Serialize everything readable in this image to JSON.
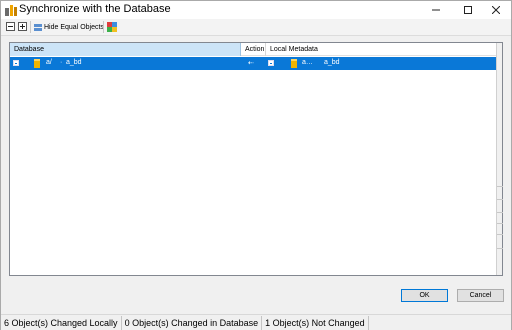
{
  "window": {
    "title": "Synchronize with the Database"
  },
  "toolbar": {
    "hide_equal_label": "Hide Equal Objects"
  },
  "grid": {
    "columns": {
      "database": "Database",
      "action": "Action",
      "local": "Local Metadata"
    },
    "rows": [
      {
        "db_name": "a_bd",
        "db_prefix": "a/",
        "db_mark": "·",
        "local_name": "a_bd",
        "local_prefix": "a…",
        "action": "⇠"
      }
    ]
  },
  "buttons": {
    "ok": "OK",
    "cancel": "Cancel"
  },
  "status": {
    "changed_locally": "6 Object(s) Changed Locally",
    "changed_in_db": "0 Object(s) Changed in Database",
    "not_changed": "1 Object(s) Not Changed"
  },
  "colors": {
    "selection": "#0a78d7",
    "header_selected": "#cce4f7"
  }
}
